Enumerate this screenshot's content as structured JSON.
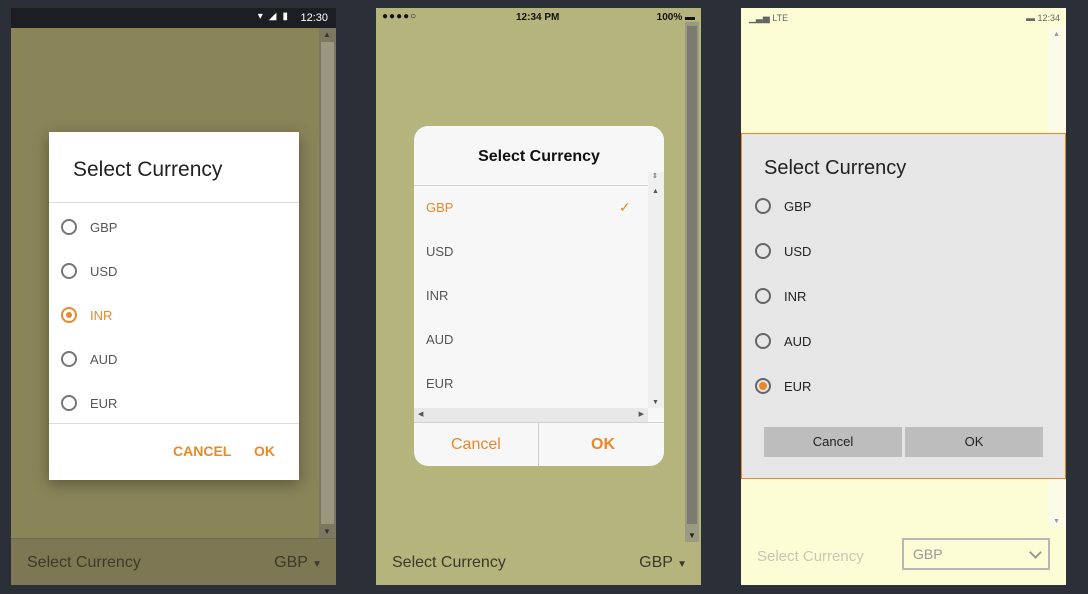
{
  "colors": {
    "accent": "#e8892a",
    "android_bg": "#8a8459",
    "ios_bg": "#b5b47d",
    "windows_bg": "#fcfdd4"
  },
  "android": {
    "status_time": "12:30",
    "status_icons": [
      "wifi-icon",
      "signal-icon",
      "battery-icon"
    ],
    "dialog_title": "Select Currency",
    "options": [
      {
        "label": "GBP",
        "selected": false
      },
      {
        "label": "USD",
        "selected": false
      },
      {
        "label": "INR",
        "selected": true
      },
      {
        "label": "AUD",
        "selected": false
      },
      {
        "label": "EUR",
        "selected": false
      }
    ],
    "cancel_label": "CANCEL",
    "ok_label": "OK",
    "picker_label": "Select Currency",
    "picker_value": "GBP"
  },
  "ios": {
    "status_carrier": "●●●●○",
    "status_time": "12:34 PM",
    "status_battery": "100%",
    "dialog_title": "Select Currency",
    "options": [
      {
        "label": "GBP",
        "selected": true
      },
      {
        "label": "USD",
        "selected": false
      },
      {
        "label": "INR",
        "selected": false
      },
      {
        "label": "AUD",
        "selected": false
      },
      {
        "label": "EUR",
        "selected": false
      }
    ],
    "cancel_label": "Cancel",
    "ok_label": "OK",
    "picker_label": "Select Currency",
    "picker_value": "GBP"
  },
  "windows": {
    "status_signal": "LTE",
    "status_time": "12:34",
    "dialog_title": "Select Currency",
    "options": [
      {
        "label": "GBP",
        "selected": false
      },
      {
        "label": "USD",
        "selected": false
      },
      {
        "label": "INR",
        "selected": false
      },
      {
        "label": "AUD",
        "selected": false
      },
      {
        "label": "EUR",
        "selected": true
      }
    ],
    "cancel_label": "Cancel",
    "ok_label": "OK",
    "picker_label": "Select Currency",
    "picker_value": "GBP"
  }
}
